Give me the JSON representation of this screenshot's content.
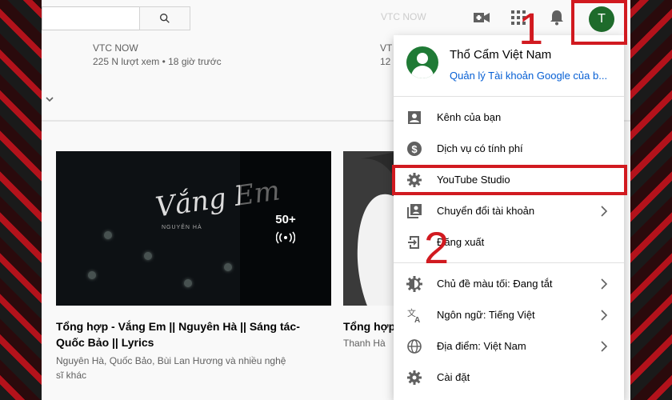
{
  "header": {
    "avatar_letter": "T",
    "faded_upper_right": "VTC NOW"
  },
  "top_strip": {
    "left_card": {
      "channel": "VTC NOW",
      "meta": "225 N lượt xem • 18 giờ trước"
    },
    "right_card": {
      "channel": "VT",
      "meta": "12"
    }
  },
  "videos": [
    {
      "title_line1": "Tổng hợp - Vắng Em || Nguyên Hà || Sáng tác-",
      "title_line2": "Quốc Bảo || Lyrics",
      "artist_line1": "Nguyên Hà, Quốc Bảo, Bùi Lan Hương và nhiều nghệ",
      "artist_line2": "sĩ khác",
      "count": "50+",
      "thumb_script": "Vắng Em",
      "thumb_sub": "NGUYÊN HÀ"
    },
    {
      "title_line1": "Tổng hợp",
      "artist_line1": "Thanh Hà"
    }
  ],
  "menu": {
    "name": "Thổ Cẩm Việt Nam",
    "manage_link": "Quản lý Tài khoản Google của b...",
    "section1": [
      {
        "label": "Kênh của bạn",
        "icon": "person-box-icon"
      },
      {
        "label": "Dịch vụ có tính phí",
        "icon": "dollar-icon"
      },
      {
        "label": "YouTube Studio",
        "icon": "gear-icon"
      },
      {
        "label": "Chuyển đổi tài khoản",
        "icon": "switch-account-icon"
      },
      {
        "label": "Đăng xuất",
        "icon": "sign-out-icon"
      }
    ],
    "section2": [
      {
        "label": "Chủ đề màu tối: Đang tắt",
        "icon": "dark-theme-icon"
      },
      {
        "label": "Ngôn ngữ: Tiếng Việt",
        "icon": "translate-icon"
      },
      {
        "label": "Địa điểm: Việt Nam",
        "icon": "globe-icon"
      },
      {
        "label": "Cài đặt",
        "icon": "settings-icon"
      }
    ]
  },
  "annotations": {
    "step1": "1",
    "step2": "2"
  },
  "colors": {
    "annotation_red": "#d11a20",
    "link_blue": "#065fd4",
    "avatar_green": "#1e6b2b"
  }
}
